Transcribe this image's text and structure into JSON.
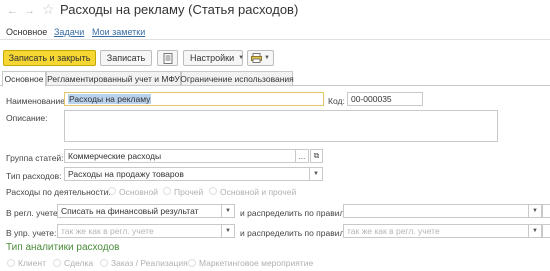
{
  "window": {
    "title": "Расходы на рекламу (Статья расходов)"
  },
  "nav_tabs": [
    {
      "label": "Основное"
    },
    {
      "label": "Задачи"
    },
    {
      "label": "Мои заметки"
    }
  ],
  "toolbar": {
    "save_close_label": "Записать и закрыть",
    "save_label": "Записать",
    "settings_label": "Настройки"
  },
  "tabs": [
    {
      "label": "Основное"
    },
    {
      "label": "Регламентированный учет и МФУ"
    },
    {
      "label": "Ограничение использования"
    }
  ],
  "form": {
    "name_label": "Наименование:",
    "name_value": "Расходы на рекламу",
    "code_label": "Код:",
    "code_value": "00-000035",
    "description_label": "Описание:",
    "group_label": "Группа статей:",
    "group_value": "Коммерческие расходы",
    "type_label": "Тип расходов:",
    "type_value": "Расходы на продажу товаров",
    "activity_label": "Расходы по деятельности:",
    "activity_options": [
      "Основной",
      "Прочей",
      "Основной и прочей"
    ],
    "reg_label": "В регл. учете:",
    "reg_value": "Списать на финансовый результат",
    "distribute_label": "и распределить по правилу:",
    "mgmt_label": "В упр. учете:",
    "mgmt_placeholder": "так же как в регл. учете",
    "distribute2_label": "и распределить по правилу:",
    "distribute2_placeholder": "так же как в регл. учете"
  },
  "analytics": {
    "title": "Тип аналитики расходов",
    "options": [
      "Клиент",
      "Сделка",
      "Заказ / Реализация",
      "Маркетинговое мероприятие"
    ]
  }
}
